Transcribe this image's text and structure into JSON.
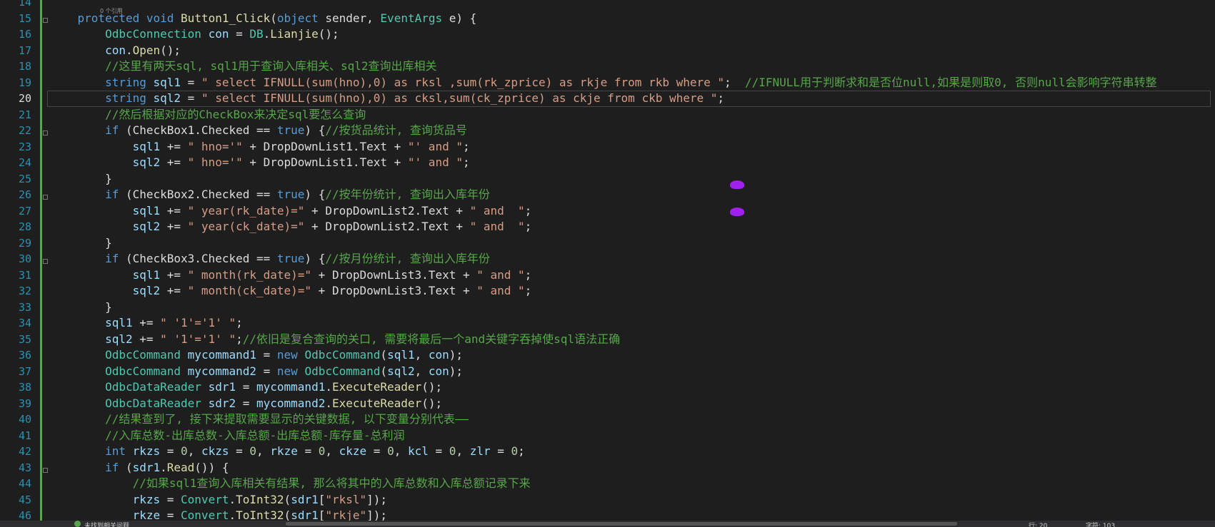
{
  "editor": {
    "codelens": "0 个引用",
    "current_line": "20",
    "lines": [
      {
        "n": "14",
        "html": ""
      },
      {
        "n": "15",
        "html": "    <span class=\"kw\">protected</span> <span class=\"kw\">void</span> <span class=\"fn\">Button1_Click</span>(<span class=\"kw\">object</span> sender, <span class=\"ty\">EventArgs</span> e) {"
      },
      {
        "n": "16",
        "html": "        <span class=\"ty\">OdbcConnection</span> <span class=\"va\">con</span> = <span class=\"ty\">DB</span>.<span class=\"fn\">Lianjie</span>();"
      },
      {
        "n": "17",
        "html": "        <span class=\"va\">con</span>.<span class=\"fn\">Open</span>();"
      },
      {
        "n": "18",
        "html": "        <span class=\"cm\">//这里有两天sql, sql1用于查询入库相关、sql2查询出库相关</span>"
      },
      {
        "n": "19",
        "html": "        <span class=\"kw\">string</span> <span class=\"va\">sql1</span> = <span class=\"st\">\" select IFNULL(sum(hno),0) as rksl ,sum(rk_zprice) as rkje from rkb where \"</span>;  <span class=\"cm\">//IFNULL用于判断求和是否位null,如果是则取0, 否则null会影响字符串转整</span>"
      },
      {
        "n": "20",
        "html": "        <span class=\"kw\">string</span> <span class=\"va\">sql2</span> = <span class=\"st\">\" select IFNULL(sum(hno),0) as cksl,sum(ck_zprice) as ckje from ckb where \"</span>;"
      },
      {
        "n": "21",
        "html": "        <span class=\"cm\">//然后根据对应的CheckBox来决定sql要怎么查询</span>"
      },
      {
        "n": "22",
        "html": "        <span class=\"kw\">if</span> (CheckBox1.Checked == <span class=\"kw\">true</span>) {<span class=\"cm\">//按货品统计, 查询货品号</span>"
      },
      {
        "n": "23",
        "html": "            <span class=\"va\">sql1</span> += <span class=\"st\">\" hno='\"</span> + DropDownList1.Text + <span class=\"st\">\"' and \"</span>;"
      },
      {
        "n": "24",
        "html": "            <span class=\"va\">sql2</span> += <span class=\"st\">\" hno='\"</span> + DropDownList1.Text + <span class=\"st\">\"' and \"</span>;"
      },
      {
        "n": "25",
        "html": "        }"
      },
      {
        "n": "26",
        "html": "        <span class=\"kw\">if</span> (CheckBox2.Checked == <span class=\"kw\">true</span>) {<span class=\"cm\">//按年份统计, 查询出入库年份</span>"
      },
      {
        "n": "27",
        "html": "            <span class=\"va\">sql1</span> += <span class=\"st\">\" year(rk_date)=\"</span> + DropDownList2.Text + <span class=\"st\">\" and  \"</span>;"
      },
      {
        "n": "28",
        "html": "            <span class=\"va\">sql2</span> += <span class=\"st\">\" year(ck_date)=\"</span> + DropDownList2.Text + <span class=\"st\">\" and  \"</span>;"
      },
      {
        "n": "29",
        "html": "        }"
      },
      {
        "n": "30",
        "html": "        <span class=\"kw\">if</span> (CheckBox3.Checked == <span class=\"kw\">true</span>) {<span class=\"cm\">//按月份统计, 查询出入库年份</span>"
      },
      {
        "n": "31",
        "html": "            <span class=\"va\">sql1</span> += <span class=\"st\">\" month(rk_date)=\"</span> + DropDownList3.Text + <span class=\"st\">\" and \"</span>;"
      },
      {
        "n": "32",
        "html": "            <span class=\"va\">sql2</span> += <span class=\"st\">\" month(ck_date)=\"</span> + DropDownList3.Text + <span class=\"st\">\" and \"</span>;"
      },
      {
        "n": "33",
        "html": "        }"
      },
      {
        "n": "34",
        "html": "        <span class=\"va\">sql1</span> += <span class=\"st\">\" '1'='1' \"</span>;"
      },
      {
        "n": "35",
        "html": "        <span class=\"va\">sql2</span> += <span class=\"st\">\" '1'='1' \"</span>;<span class=\"cm\">//依旧是复合查询的关口, 需要将最后一个and关键字吞掉使sql语法正确</span>"
      },
      {
        "n": "36",
        "html": "        <span class=\"ty\">OdbcCommand</span> <span class=\"va\">mycommand1</span> = <span class=\"kw\">new</span> <span class=\"ty\">OdbcCommand</span>(<span class=\"va\">sql1</span>, <span class=\"va\">con</span>);"
      },
      {
        "n": "37",
        "html": "        <span class=\"ty\">OdbcCommand</span> <span class=\"va\">mycommand2</span> = <span class=\"kw\">new</span> <span class=\"ty\">OdbcCommand</span>(<span class=\"va\">sql2</span>, <span class=\"va\">con</span>);"
      },
      {
        "n": "38",
        "html": "        <span class=\"ty\">OdbcDataReader</span> <span class=\"va\">sdr1</span> = <span class=\"va\">mycommand1</span>.<span class=\"fn\">ExecuteReader</span>();"
      },
      {
        "n": "39",
        "html": "        <span class=\"ty\">OdbcDataReader</span> <span class=\"va\">sdr2</span> = <span class=\"va\">mycommand2</span>.<span class=\"fn\">ExecuteReader</span>();"
      },
      {
        "n": "40",
        "html": "        <span class=\"cm\">//结果查到了, 接下来提取需要显示的关键数据, 以下变量分别代表——</span>"
      },
      {
        "n": "41",
        "html": "        <span class=\"cm\">//入库总数-出库总数-入库总额-出库总额-库存量-总利润</span>"
      },
      {
        "n": "42",
        "html": "        <span class=\"kw\">int</span> <span class=\"va\">rkzs</span> = <span class=\"nu\">0</span>, <span class=\"va\">ckzs</span> = <span class=\"nu\">0</span>, <span class=\"va\">rkze</span> = <span class=\"nu\">0</span>, <span class=\"va\">ckze</span> = <span class=\"nu\">0</span>, <span class=\"va\">kcl</span> = <span class=\"nu\">0</span>, <span class=\"va\">zlr</span> = <span class=\"nu\">0</span>;"
      },
      {
        "n": "43",
        "html": "        <span class=\"kw\">if</span> (<span class=\"va\">sdr1</span>.<span class=\"fn\">Read</span>()) {"
      },
      {
        "n": "44",
        "html": "            <span class=\"cm\">//如果sql1查询入库相关有结果, 那么将其中的入库总数和入库总额记录下来</span>"
      },
      {
        "n": "45",
        "html": "            <span class=\"va\">rkzs</span> = <span class=\"ty\">Convert</span>.<span class=\"fn\">ToInt32</span>(<span class=\"va\">sdr1</span>[<span class=\"st\">\"rksl\"</span>]);"
      },
      {
        "n": "46",
        "html": "            <span class=\"va\">rkze</span> = <span class=\"ty\">Convert</span>.<span class=\"fn\">ToInt32</span>(<span class=\"va\">sdr1</span>[<span class=\"st\">\"rkje\"</span>]);"
      }
    ]
  },
  "statusbar": {
    "issues_text": "未找到相关问题",
    "line_col": "行: 20",
    "char": "字符: 103"
  }
}
